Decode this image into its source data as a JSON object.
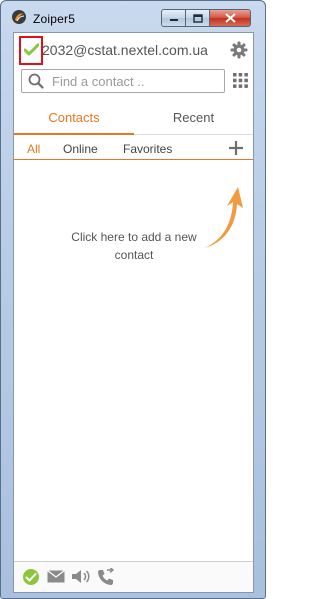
{
  "window": {
    "title": "Zoiper5"
  },
  "account": {
    "name": "2032@cstat.nextel.com.ua",
    "status": "online"
  },
  "search": {
    "placeholder": "Find a contact .."
  },
  "tabs": [
    {
      "label": "Contacts",
      "active": true
    },
    {
      "label": "Recent",
      "active": false
    }
  ],
  "filters": [
    {
      "label": "All",
      "active": true
    },
    {
      "label": "Online",
      "active": false
    },
    {
      "label": "Favorites",
      "active": false
    }
  ],
  "empty_state": {
    "message": "Click here to add a new contact"
  },
  "bottom_bar": {
    "icons": [
      "status-online-icon",
      "message-icon",
      "speaker-icon",
      "call-forward-icon"
    ]
  },
  "colors": {
    "accent": "#e87722",
    "status_green": "#8cc63f",
    "highlight_red": "#e0101b"
  }
}
